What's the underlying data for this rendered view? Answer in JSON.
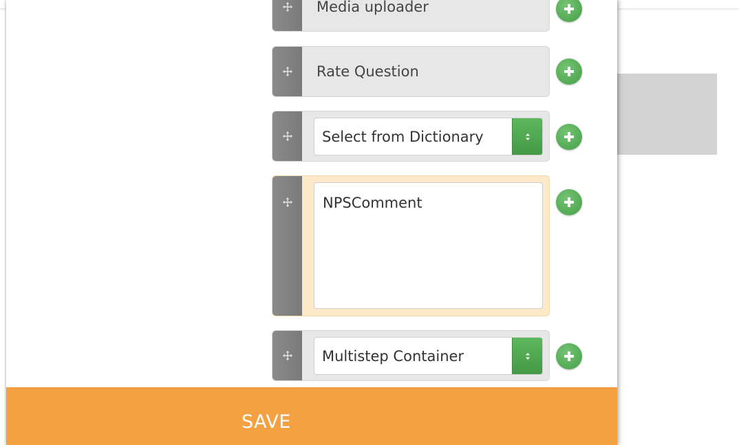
{
  "colors": {
    "save_bar": "#f3a143",
    "add_button": "#5cb85c",
    "handle": "#808080",
    "row_bg": "#e7e7e7",
    "active_row_bg": "#fde8c8"
  },
  "fields": [
    {
      "type": "label",
      "label": "Media uploader",
      "icon": "move-icon"
    },
    {
      "type": "label",
      "label": "Rate Question",
      "icon": "move-icon"
    },
    {
      "type": "select",
      "value": "Select from Dictionary",
      "icon": "move-icon"
    },
    {
      "type": "textarea",
      "value": "NPSComment",
      "icon": "move-icon"
    },
    {
      "type": "select",
      "value": "Multistep Container",
      "icon": "move-icon"
    }
  ],
  "save_label": "SAVE"
}
